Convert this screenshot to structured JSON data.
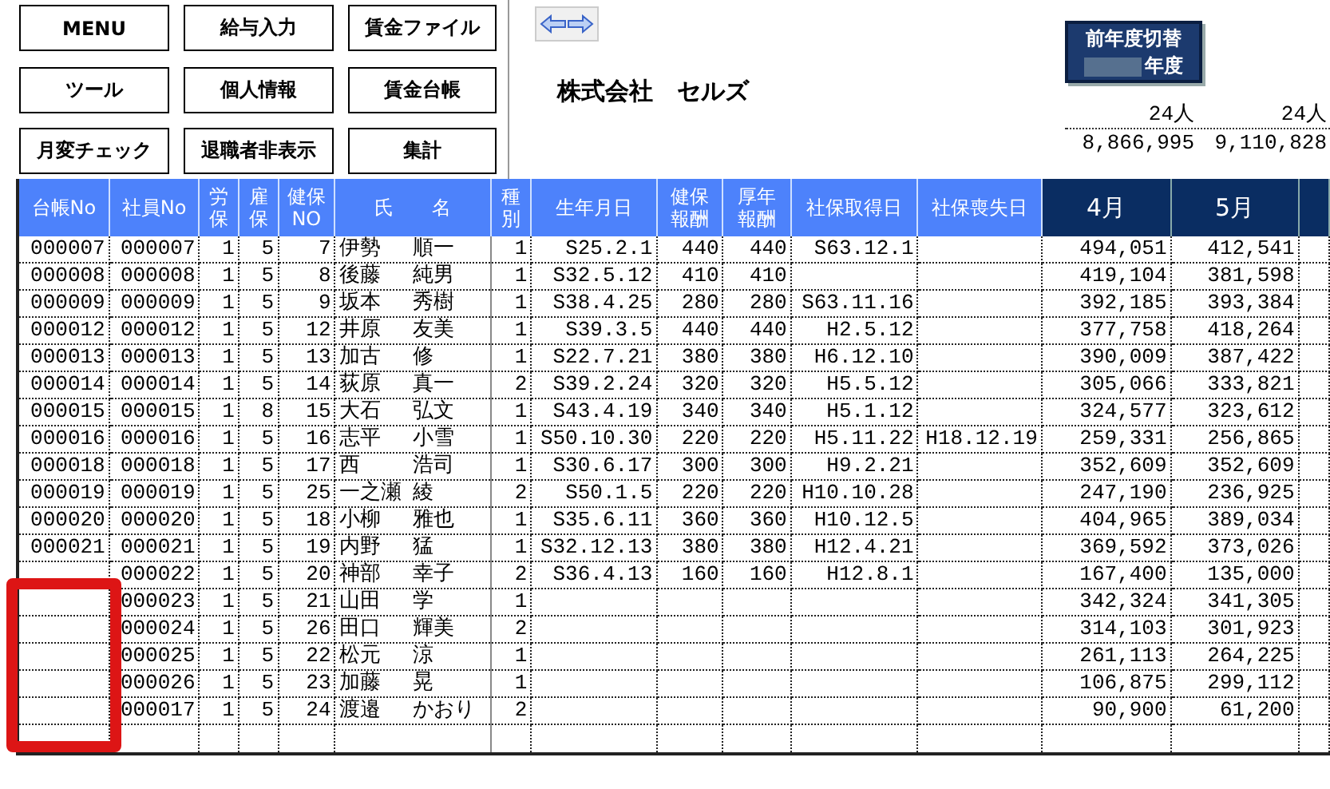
{
  "menu_buttons": [
    "MENU",
    "給与入力",
    "賃金ファイル",
    "ツール",
    "個人情報",
    "賃金台帳",
    "月変チェック",
    "退職者非表示",
    "集計"
  ],
  "company": "株式会社　セルズ",
  "year_switch": {
    "label": "前年度切替",
    "year_suffix": "年度"
  },
  "totals": {
    "headcount": [
      "24人",
      "24人"
    ],
    "amounts": [
      "8,866,995",
      "9,110,828"
    ]
  },
  "columns": [
    {
      "label": "台帳No",
      "kind": "field"
    },
    {
      "label": "社員No",
      "kind": "field"
    },
    {
      "label": "労保",
      "kind": "field"
    },
    {
      "label": "雇保",
      "kind": "field"
    },
    {
      "label": "健保\nNO",
      "kind": "field"
    },
    {
      "label": "氏　　名",
      "kind": "field"
    },
    {
      "label": "種別",
      "kind": "field"
    },
    {
      "label": "生年月日",
      "kind": "field"
    },
    {
      "label": "健保報酬",
      "kind": "field"
    },
    {
      "label": "厚年報酬",
      "kind": "field"
    },
    {
      "label": "社保取得日",
      "kind": "field"
    },
    {
      "label": "社保喪失日",
      "kind": "field"
    },
    {
      "label": "4月",
      "kind": "month"
    },
    {
      "label": "5月",
      "kind": "month"
    }
  ],
  "rows": [
    {
      "cells": [
        "000007",
        "000007",
        "1",
        "5",
        "7",
        [
          "伊勢",
          "順一"
        ],
        "1",
        "S25.2.1",
        "440",
        "440",
        "S63.12.1",
        null,
        "494,051",
        "412,541"
      ]
    },
    {
      "cells": [
        "000008",
        "000008",
        "1",
        "5",
        "8",
        [
          "後藤",
          "純男"
        ],
        "1",
        "S32.5.12",
        "410",
        "410",
        null,
        null,
        "419,104",
        "381,598"
      ]
    },
    {
      "cells": [
        "000009",
        "000009",
        "1",
        "5",
        "9",
        [
          "坂本",
          "秀樹"
        ],
        "1",
        "S38.4.25",
        "280",
        "280",
        "S63.11.16",
        null,
        "392,185",
        "393,384"
      ]
    },
    {
      "cells": [
        "000012",
        "000012",
        "1",
        "5",
        "12",
        [
          "井原",
          "友美"
        ],
        "1",
        "S39.3.5",
        "440",
        "440",
        "H2.5.12",
        null,
        "377,758",
        "418,264"
      ]
    },
    {
      "cells": [
        "000013",
        "000013",
        "1",
        "5",
        "13",
        [
          "加古",
          "修"
        ],
        "1",
        "S22.7.21",
        "380",
        "380",
        "H6.12.10",
        null,
        "390,009",
        "387,422"
      ]
    },
    {
      "cells": [
        "000014",
        "000014",
        "1",
        "5",
        "14",
        [
          "荻原",
          "真一"
        ],
        "2",
        "S39.2.24",
        "320",
        "320",
        "H5.5.12",
        null,
        "305,066",
        "333,821"
      ]
    },
    {
      "cells": [
        "000015",
        "000015",
        "1",
        "8",
        "15",
        [
          "大石",
          "弘文"
        ],
        "1",
        "S43.4.19",
        "340",
        "340",
        "H5.1.12",
        null,
        "324,577",
        "323,612"
      ]
    },
    {
      "cells": [
        "000016",
        "000016",
        "1",
        "5",
        "16",
        [
          "志平",
          "小雪"
        ],
        "1",
        "S50.10.30",
        "220",
        "220",
        "H5.11.22",
        "H18.12.19",
        "259,331",
        "256,865"
      ]
    },
    {
      "cells": [
        "000018",
        "000018",
        "1",
        "5",
        "17",
        [
          "西",
          "浩司"
        ],
        "1",
        "S30.6.17",
        "300",
        "300",
        "H9.2.21",
        null,
        "352,609",
        "352,609"
      ]
    },
    {
      "cells": [
        "000019",
        "000019",
        "1",
        "5",
        "25",
        [
          "一之瀬",
          "綾"
        ],
        "2",
        "S50.1.5",
        "220",
        "220",
        "H10.10.28",
        null,
        "247,190",
        "236,925"
      ]
    },
    {
      "cells": [
        "000020",
        "000020",
        "1",
        "5",
        "18",
        [
          "小柳",
          "雅也"
        ],
        "1",
        "S35.6.11",
        "360",
        "360",
        "H10.12.5",
        null,
        "404,965",
        "389,034"
      ]
    },
    {
      "cells": [
        "000021",
        "000021",
        "1",
        "5",
        "19",
        [
          "内野",
          "猛"
        ],
        "1",
        "S32.12.13",
        "380",
        "380",
        "H12.4.21",
        null,
        "369,592",
        "373,026"
      ]
    },
    {
      "cells": [
        null,
        "000022",
        "1",
        "5",
        "20",
        [
          "神部",
          "幸子"
        ],
        "2",
        "S36.4.13",
        "160",
        "160",
        "H12.8.1",
        null,
        "167,400",
        "135,000"
      ]
    },
    {
      "cells": [
        null,
        "000023",
        "1",
        "5",
        "21",
        [
          "山田",
          "学"
        ],
        "1",
        null,
        null,
        null,
        null,
        null,
        "342,324",
        "341,305"
      ]
    },
    {
      "cells": [
        null,
        "000024",
        "1",
        "5",
        "26",
        [
          "田口",
          "輝美"
        ],
        "2",
        null,
        null,
        null,
        null,
        null,
        "314,103",
        "301,923"
      ]
    },
    {
      "cells": [
        null,
        "000025",
        "1",
        "5",
        "22",
        [
          "松元",
          "涼"
        ],
        "1",
        null,
        null,
        null,
        null,
        null,
        "261,113",
        "264,225"
      ]
    },
    {
      "cells": [
        null,
        "000026",
        "1",
        "5",
        "23",
        [
          "加藤",
          "晃"
        ],
        "1",
        null,
        null,
        null,
        null,
        null,
        "106,875",
        "299,112"
      ]
    },
    {
      "cells": [
        null,
        "000017",
        "1",
        "5",
        "24",
        [
          "渡邉",
          "かおり"
        ],
        "2",
        null,
        null,
        null,
        null,
        null,
        "90,900",
        "61,200"
      ]
    }
  ]
}
